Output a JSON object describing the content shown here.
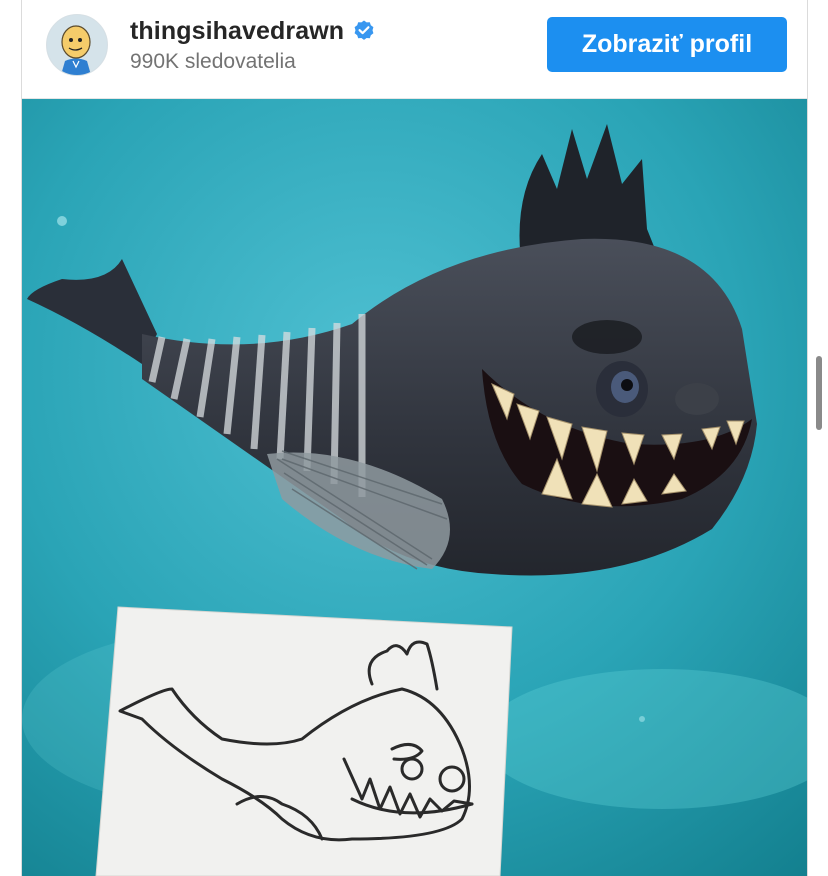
{
  "post": {
    "author": {
      "username": "thingsihavedrawn",
      "verified": true,
      "followers_text": "990K sledovatelia",
      "avatar_icon": "cartoon-avatar-icon"
    },
    "view_profile_label": "Zobraziť profil",
    "image": {
      "subject": "fish-photo-with-child-drawing",
      "icons": [
        "verified-badge-icon",
        "fish-icon"
      ]
    }
  },
  "colors": {
    "accent": "#1c8ff0",
    "username": "#262626",
    "secondary_text": "#737373",
    "verified": "#3897f0",
    "water": "#2fa6b8"
  }
}
